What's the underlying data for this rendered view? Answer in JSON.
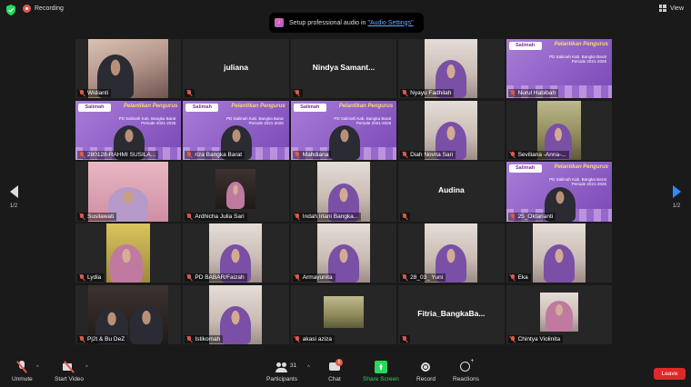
{
  "top": {
    "recording_label": "Recording",
    "view_label": "View",
    "notice_text": "Setup professional audio in",
    "notice_link": "\"Audio Settings\""
  },
  "banner": {
    "logo": "Salimah",
    "title_line1": "Pelantikan Pengurus",
    "title_line2": "PD Salimah Kab. Bangka Barat",
    "title_line3": "Periode 2021-2026"
  },
  "tiles": [
    {
      "name": "Widianti",
      "video": "room",
      "show_label": true
    },
    {
      "name": "juliana",
      "video": "none",
      "show_label": true
    },
    {
      "name": "Nindya  Samant...",
      "video": "none",
      "show_label": true
    },
    {
      "name": "Nyayu Fadhilah",
      "video": "light",
      "show_label": true
    },
    {
      "name": "Nurul Habibah",
      "video": "banner",
      "show_label": true
    },
    {
      "name": "280128-RAHMI  SUSILA...",
      "video": "banner-person",
      "show_label": true,
      "active": true
    },
    {
      "name": "riza Bangka Barat",
      "video": "banner-person",
      "show_label": true
    },
    {
      "name": "Mahdiana",
      "video": "banner-person",
      "show_label": true
    },
    {
      "name": "Diah Novita Sari",
      "video": "light",
      "show_label": true
    },
    {
      "name": "Seviliana -Anna-...",
      "video": "green",
      "show_label": true
    },
    {
      "name": "Susilawati",
      "video": "pink",
      "show_label": true
    },
    {
      "name": "Ardhicha Julia Sari",
      "video": "dark-frame",
      "show_label": true
    },
    {
      "name": "Indah Irlani Bangka...",
      "video": "light",
      "show_label": true
    },
    {
      "name": "Audina",
      "video": "none",
      "show_label": true
    },
    {
      "name": "25_Oktarianti",
      "video": "banner-person",
      "show_label": true
    },
    {
      "name": "Lydia",
      "video": "yellow",
      "show_label": true
    },
    {
      "name": "PD BABAR/Faizah",
      "video": "light",
      "show_label": true
    },
    {
      "name": "Armayunita",
      "video": "light",
      "show_label": true
    },
    {
      "name": "28_03_ Yuni",
      "video": "light",
      "show_label": true
    },
    {
      "name": "Eka",
      "video": "light",
      "show_label": true
    },
    {
      "name": "Pj2t & Bu DeZ",
      "video": "dark",
      "show_label": true
    },
    {
      "name": "Istikomah",
      "video": "light",
      "show_label": true
    },
    {
      "name": "akasi aziza",
      "video": "photo-small",
      "show_label": true
    },
    {
      "name": "Fitria_BangkaBa...",
      "video": "none",
      "show_label": true
    },
    {
      "name": "Chintya Violinita",
      "video": "portrait-small",
      "show_label": true
    }
  ],
  "page": {
    "left": "1/2",
    "right": "1/2"
  },
  "toolbar": {
    "unmute": "Unmute",
    "start_video": "Start Video",
    "participants": "Participants",
    "participants_count": "31",
    "chat": "Chat",
    "chat_badge": "5",
    "share_screen": "Share Screen",
    "record": "Record",
    "reactions": "Reactions",
    "leave": "Leave"
  },
  "colors": {
    "accent_share": "#23d959",
    "leave_red": "#e02828",
    "active_speaker": "#e8e04a",
    "arrow_blue": "#2d8cff"
  }
}
